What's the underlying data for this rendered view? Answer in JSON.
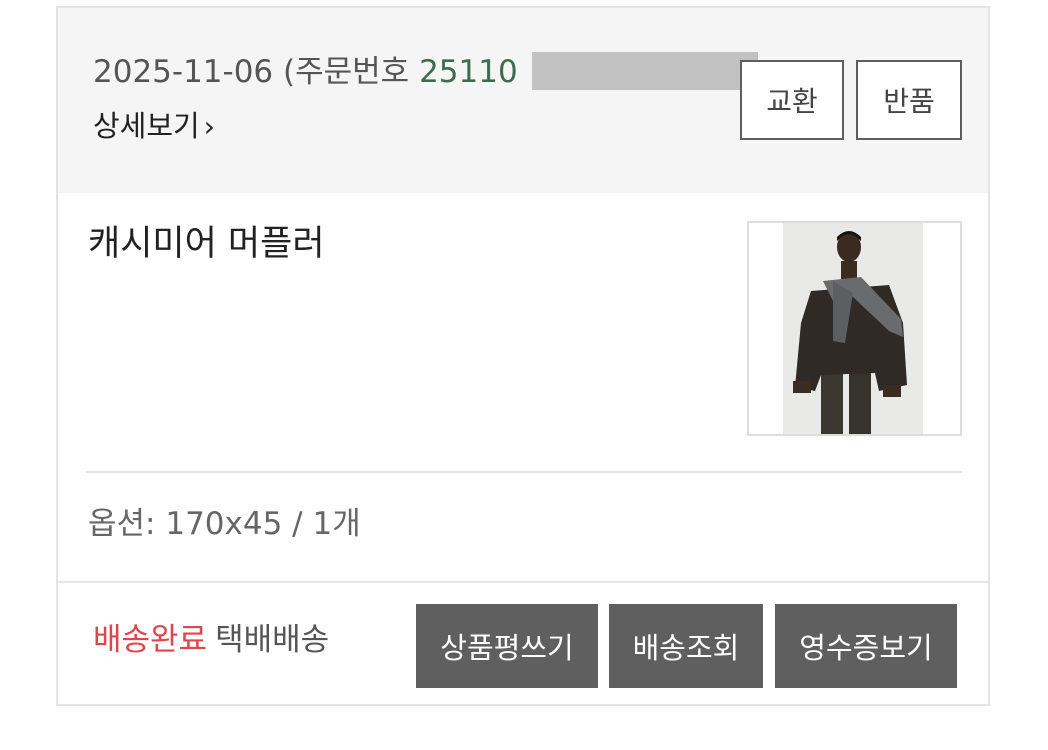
{
  "order": {
    "date": "2025-11-06",
    "order_prefix": "(주문번호 ",
    "order_number_visible": "25110",
    "detail_label": "상세보기",
    "detail_chevron": "›",
    "exchange_label": "교환",
    "return_label": "반품"
  },
  "product": {
    "name": "캐시미어 머플러",
    "image_icon": "product-photo",
    "option_prefix": "옵션: ",
    "option_value": "170x45",
    "option_sep": " /  ",
    "quantity": "1개"
  },
  "shipping": {
    "status": "배송완료",
    "method": "택배배송"
  },
  "actions": {
    "review_label": "상품평쓰기",
    "track_label": "배송조회",
    "receipt_label": "영수증보기"
  },
  "colors": {
    "order_number": "#3f6b4f",
    "status_done": "#e0454b",
    "dark_button": "#5f5f5f",
    "header_bg": "#f5f5f5"
  }
}
